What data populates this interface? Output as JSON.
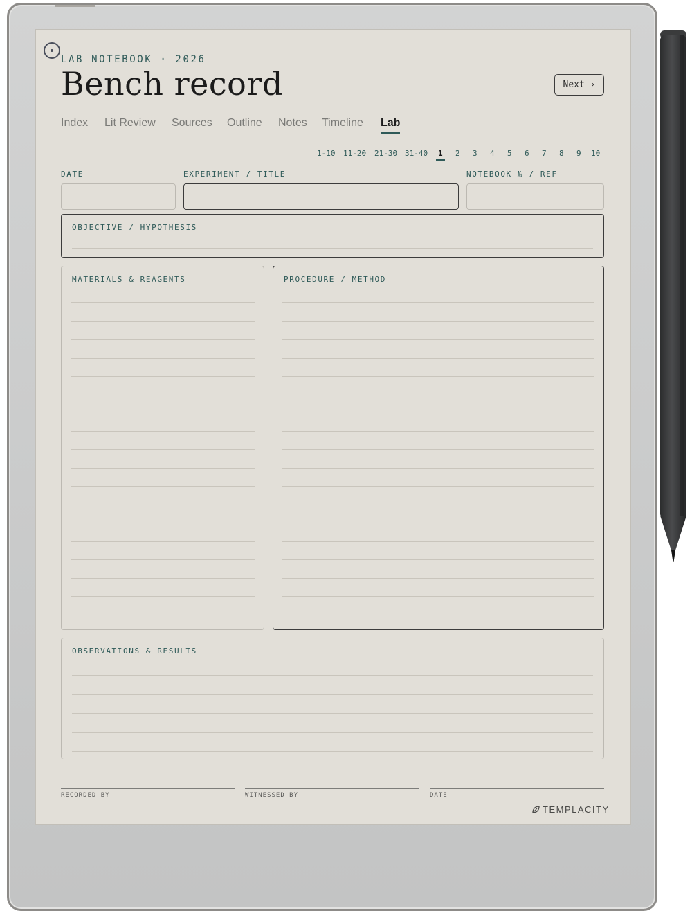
{
  "header": {
    "eyebrow": "LAB NOTEBOOK · 2026",
    "title": "Bench record",
    "next_label": "Next ›"
  },
  "tabs": [
    {
      "label": "Index",
      "active": false
    },
    {
      "label": "Lit Review",
      "active": false
    },
    {
      "label": "Sources",
      "active": false
    },
    {
      "label": "Outline",
      "active": false
    },
    {
      "label": "Notes",
      "active": false
    },
    {
      "label": "Timeline",
      "active": false
    },
    {
      "label": "Lab",
      "active": true
    }
  ],
  "pager": {
    "ranges": [
      "1-10",
      "11-20",
      "21-30",
      "31-40"
    ],
    "pages": [
      "1",
      "2",
      "3",
      "4",
      "5",
      "6",
      "7",
      "8",
      "9",
      "10"
    ],
    "current": "1"
  },
  "fields": {
    "date_label": "DATE",
    "experiment_label": "EXPERIMENT / TITLE",
    "notebook_label": "NOTEBOOK № / REF"
  },
  "sections": {
    "objective": "OBJECTIVE / HYPOTHESIS",
    "materials": "MATERIALS & REAGENTS",
    "procedure": "PROCEDURE / METHOD",
    "observations": "OBSERVATIONS & RESULTS"
  },
  "footer": {
    "recorded_by": "RECORDED BY",
    "witnessed_by": "WITNESSED BY",
    "date": "DATE",
    "brand": "TEMPLACITY"
  },
  "colors": {
    "accent": "#2f5a58",
    "paper": "#e2dfd8",
    "ink": "#1b1b1b"
  }
}
